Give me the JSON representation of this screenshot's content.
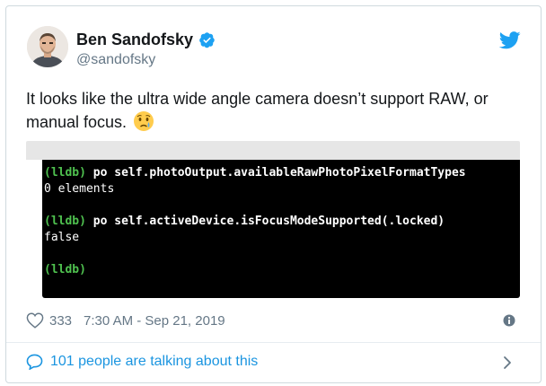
{
  "author": {
    "name": "Ben Sandofsky",
    "handle": "@sandofsky",
    "verified": true
  },
  "tweet": {
    "text": "It looks like the ultra wide angle camera doesn’t support RAW, or manual focus.",
    "emoji": "crying-face"
  },
  "terminal": {
    "lines": [
      {
        "prompt": "(lldb)",
        "command": " po self.photoOutput.availableRawPhotoPixelFormatTypes"
      },
      {
        "output": "0 elements"
      },
      {
        "prompt": "(lldb)",
        "command": " po self.activeDevice.isFocusModeSupported(.locked)"
      },
      {
        "output": "false"
      },
      {
        "prompt": "(lldb)",
        "command": ""
      }
    ]
  },
  "meta": {
    "likes": "333",
    "timestamp": "7:30 AM - Sep 21, 2019"
  },
  "footer": {
    "conversation": "101 people are talking about this"
  },
  "colors": {
    "accent": "#1da1f2",
    "link": "#1b95e0",
    "secondary_text": "#657786",
    "prompt_green": "#4fc14f",
    "terminal_bg": "#000000"
  }
}
